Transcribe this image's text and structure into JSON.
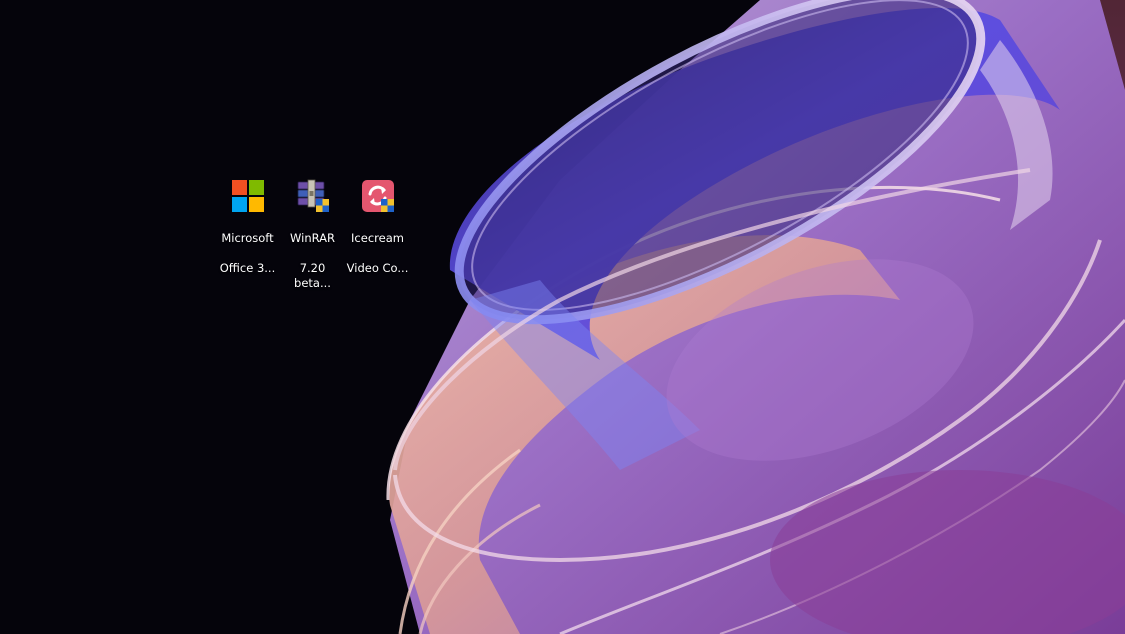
{
  "desktop": {
    "icons": [
      {
        "label_line1": "Microsoft",
        "label_line2": "Office 3...",
        "icon": "microsoft-office-logo-icon"
      },
      {
        "label_line1": "WinRAR",
        "label_line2": "7.20 beta...",
        "icon": "winrar-installer-icon"
      },
      {
        "label_line1": "Icecream",
        "label_line2": "Video Co...",
        "icon": "icecream-video-converter-icon"
      }
    ]
  },
  "colors": {
    "background": "#05040b",
    "ms_red": "#f25022",
    "ms_green": "#7fba00",
    "ms_blue": "#00a4ef",
    "ms_yellow": "#ffb900",
    "icecream_pink": "#e4566f"
  }
}
